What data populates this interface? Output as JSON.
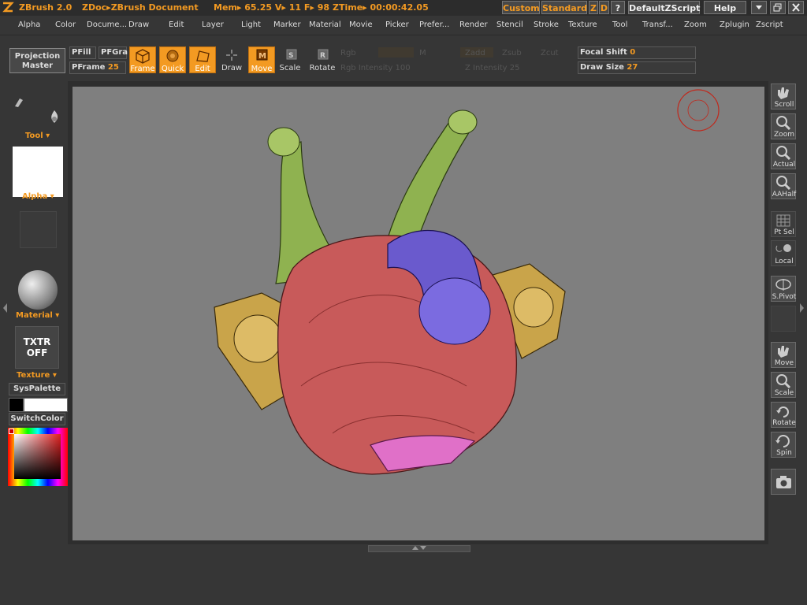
{
  "titlebar": {
    "app": "ZBrush 2.0",
    "doc": "ZDoc▸ZBrush Document",
    "mem": "Mem▸ 65.25  V▸ 11  F▸ 98",
    "ztime": "ZTime▸ 00:00:42.05",
    "custom": "Custom",
    "standard": "Standard",
    "z": "Z",
    "d": "D",
    "q": "?",
    "script": "DefaultZScript",
    "help": "Help"
  },
  "menu": [
    "Alpha",
    "Color",
    "Docume...",
    "Draw",
    "Edit",
    "Layer",
    "Light",
    "Marker",
    "Material",
    "Movie",
    "Picker",
    "Prefer...",
    "Render",
    "Stencil",
    "Stroke",
    "Texture",
    "Tool",
    "Transf...",
    "Zoom",
    "Zplugin",
    "Zscript"
  ],
  "shelf": {
    "projection_master": [
      "Projection",
      "Master"
    ],
    "pfill": "PFill",
    "pfgra": "PFGra",
    "pframe": "PFrame",
    "pframe_val": "25",
    "frame": "Frame",
    "quick": "Quick",
    "edit": "Edit",
    "draw": "Draw",
    "move": "Move",
    "scale": "Scale",
    "rotate": "Rotate",
    "rgb": "Rgb",
    "m": "M",
    "zadd": "Zadd",
    "zsub": "Zsub",
    "zcut": "Zcut",
    "rgb_intensity": "Rgb Intensity 100",
    "z_intensity": "Z Intensity 25",
    "focal_shift": "Focal Shift",
    "focal_val": "0",
    "draw_size": "Draw Size",
    "draw_size_val": "27"
  },
  "left": {
    "tool": "Tool",
    "alpha": "Alpha",
    "material": "Material",
    "txtr": [
      "TXTR",
      "OFF"
    ],
    "texture": "Texture",
    "syspalette": "SysPalette",
    "switchcolor": "SwitchColor"
  },
  "right": [
    "Scroll",
    "Zoom",
    "Actual",
    "AAHalf",
    "Pt Sel",
    "Local",
    "S.Pivot",
    "Move",
    "Scale",
    "Rotate",
    "Spin"
  ],
  "colors": {
    "accent": "#f39a22",
    "canvas": "#7f7f7f",
    "body_red": "#c85a5a",
    "stalk_green": "#8fb250",
    "ear_gold": "#c9a44a",
    "nose_blue": "#6a5acd"
  }
}
